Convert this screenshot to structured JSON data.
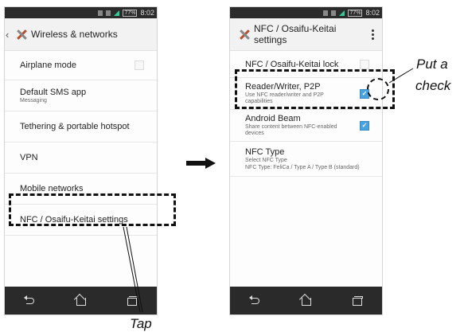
{
  "left_screen": {
    "status": {
      "battery": "77%",
      "time": "8:02"
    },
    "appbar": {
      "title": "Wireless & networks",
      "back_icon": "chevron-left-icon",
      "app_icon": "wrench-screwdriver-icon"
    },
    "items": [
      {
        "title": "Airplane mode",
        "has_checkbox": true,
        "checked": false
      },
      {
        "title": "Default SMS app",
        "subtitle": "Messaging"
      },
      {
        "title": "Tethering & portable hotspot"
      },
      {
        "title": "VPN"
      },
      {
        "title": "Mobile networks"
      },
      {
        "title": "NFC / Osaifu-Keitai settings"
      }
    ]
  },
  "right_screen": {
    "status": {
      "battery": "77%",
      "time": "8:02"
    },
    "appbar": {
      "title": "NFC / Osaifu-Keitai settings",
      "app_icon": "wrench-screwdriver-icon",
      "menu_icon": "overflow-menu-icon"
    },
    "items": [
      {
        "title": "NFC / Osaifu-Keitai lock",
        "has_checkbox": true,
        "checked": false
      },
      {
        "title": "Reader/Writer, P2P",
        "subtitle": "Use NFC reader/writer and P2P capabilities",
        "has_checkbox": true,
        "checked": true
      },
      {
        "title": "Android Beam",
        "subtitle": "Share content between NFC-enabled devices",
        "has_checkbox": true,
        "checked": true
      },
      {
        "title": "NFC Type",
        "subtitle": "Select NFC Type",
        "subtitle2": "NFC Type: FeliCa / Type A / Type B (standard)"
      }
    ]
  },
  "nav": {
    "back_icon": "back-icon",
    "home_icon": "home-icon",
    "recent_icon": "recent-apps-icon"
  },
  "annotations": {
    "tap_label": "Tap",
    "check_label_1": "Put a",
    "check_label_2": "check",
    "arrow_icon": "right-arrow-icon"
  },
  "colors": {
    "check_blue": "#4aa3df",
    "nav_bg": "#2a2a2a",
    "status_bg": "#2b2b2b"
  }
}
